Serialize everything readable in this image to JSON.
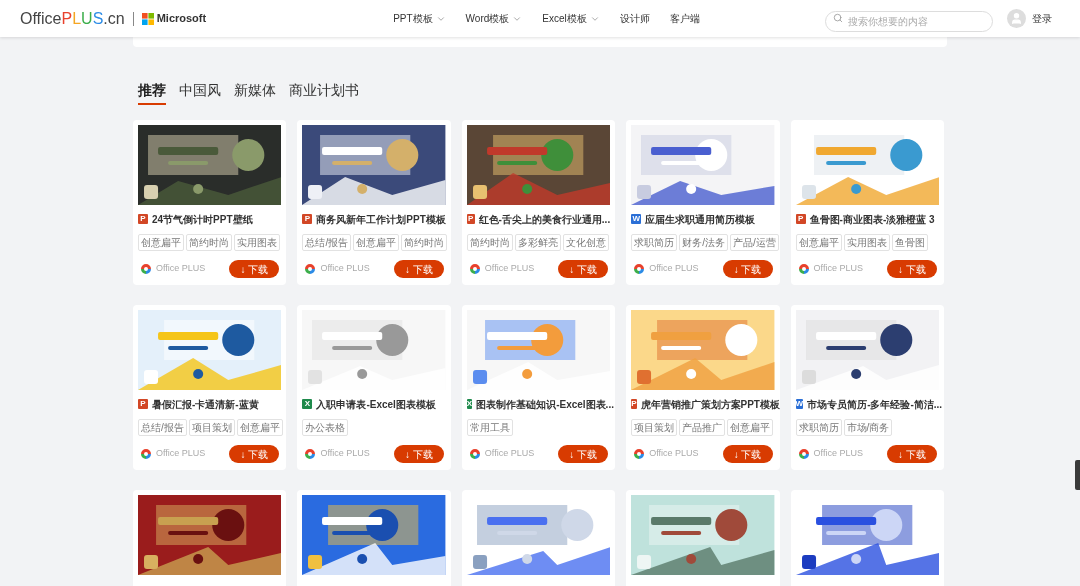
{
  "header": {
    "logo": {
      "name": "Office",
      "accent": "PLUS",
      "suffix": ".cn"
    },
    "partner": "Microsoft",
    "nav": [
      {
        "label": "PPT模板",
        "dropdown": true
      },
      {
        "label": "Word模板",
        "dropdown": true
      },
      {
        "label": "Excel模板",
        "dropdown": true
      },
      {
        "label": "设计师",
        "dropdown": false
      },
      {
        "label": "客户端",
        "dropdown": false
      }
    ],
    "search": {
      "placeholder": "搜索你想要的内容"
    },
    "login": "登录"
  },
  "tabs": [
    {
      "label": "推荐",
      "selected": true
    },
    {
      "label": "中国风",
      "selected": false
    },
    {
      "label": "新媒体",
      "selected": false
    },
    {
      "label": "商业计划书",
      "selected": false
    }
  ],
  "cards": [
    {
      "kind": "ppt",
      "badge": "P",
      "title": "24节气倒计时PPT壁纸",
      "tags": [
        "创意扁平",
        "简约时尚",
        "实用图表"
      ],
      "author": "Office PLUS",
      "download": "↓ 下载"
    },
    {
      "kind": "ppt",
      "badge": "P",
      "title": "商务风新年工作计划PPT模板",
      "tags": [
        "总结/报告",
        "创意扁平",
        "简约时尚"
      ],
      "author": "Office PLUS",
      "download": "↓ 下载"
    },
    {
      "kind": "ppt",
      "badge": "P",
      "title": "红色-舌尖上的美食行业通用...",
      "tags": [
        "简约时尚",
        "多彩鲜亮",
        "文化创意"
      ],
      "author": "Office PLUS",
      "download": "↓ 下载"
    },
    {
      "kind": "word",
      "badge": "W",
      "title": "应届生求职通用简历模板",
      "tags": [
        "求职简历",
        "财务/法务",
        "产品/运营"
      ],
      "author": "Office PLUS",
      "download": "↓ 下载"
    },
    {
      "kind": "ppt",
      "badge": "P",
      "title": "鱼骨图-商业图表-淡雅橙蓝 3",
      "tags": [
        "创意扁平",
        "实用图表",
        "鱼骨图"
      ],
      "author": "Office PLUS",
      "download": "↓ 下载"
    },
    {
      "kind": "ppt",
      "badge": "P",
      "title": "暑假汇报-卡通清新-蓝黄",
      "tags": [
        "总结/报告",
        "项目策划",
        "创意扁平"
      ],
      "author": "Office PLUS",
      "download": "↓ 下载"
    },
    {
      "kind": "excel",
      "badge": "X",
      "title": "入职申请表-Excel图表模板",
      "tags": [
        "办公表格"
      ],
      "author": "Office PLUS",
      "download": "↓ 下载"
    },
    {
      "kind": "excel",
      "badge": "X",
      "title": "图表制作基础知识-Excel图表...",
      "tags": [
        "常用工具"
      ],
      "author": "Office PLUS",
      "download": "↓ 下载"
    },
    {
      "kind": "ppt",
      "badge": "P",
      "title": "虎年营销推广策划方案PPT模板",
      "tags": [
        "项目策划",
        "产品推广",
        "创意扁平"
      ],
      "author": "Office PLUS",
      "download": "↓ 下载"
    },
    {
      "kind": "word",
      "badge": "W",
      "title": "市场专员简历-多年经验-简洁...",
      "tags": [
        "求职简历",
        "市场/商务"
      ],
      "author": "Office PLUS",
      "download": "↓ 下载"
    },
    {
      "kind": "picture"
    },
    {
      "kind": "picture"
    },
    {
      "kind": "picture"
    },
    {
      "kind": "picture"
    },
    {
      "kind": "picture"
    }
  ]
}
